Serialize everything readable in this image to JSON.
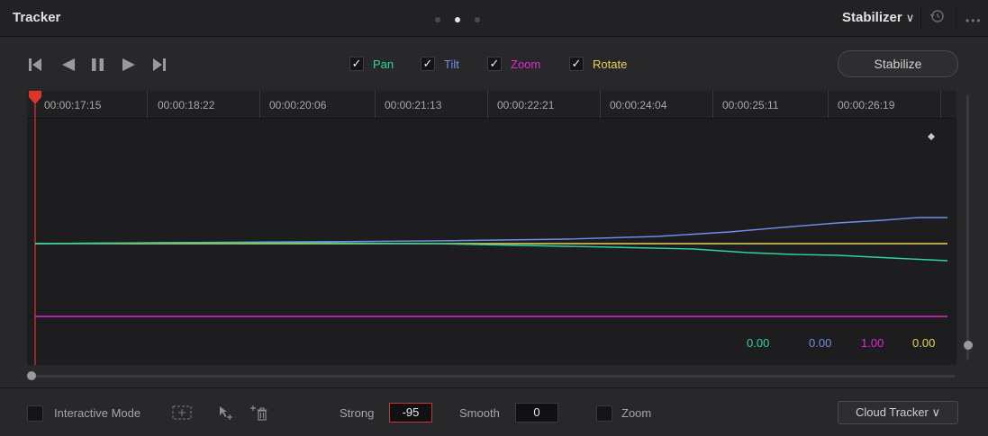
{
  "header": {
    "title": "Tracker",
    "mode_label": "Stabilizer",
    "mode_chevron": "∨",
    "reset_icon": "reset-icon",
    "more_label": "•••"
  },
  "toolbar": {
    "transport": [
      "go-to-start-icon",
      "play-reverse-icon",
      "pause-icon",
      "play-forward-icon",
      "go-to-end-icon"
    ],
    "checks": [
      {
        "label": "Pan",
        "checked": true,
        "color": "#2fd39b"
      },
      {
        "label": "Tilt",
        "checked": true,
        "color": "#6f8fe8"
      },
      {
        "label": "Zoom",
        "checked": true,
        "color": "#e02ad0"
      },
      {
        "label": "Rotate",
        "checked": true,
        "color": "#e6d35a"
      }
    ],
    "check_mark": "✓",
    "stabilize_label": "Stabilize"
  },
  "timeline": {
    "timecodes": [
      "00:00:17:15",
      "00:00:18:22",
      "00:00:20:06",
      "00:00:21:13",
      "00:00:22:21",
      "00:00:24:04",
      "00:00:25:11",
      "00:00:26:19"
    ],
    "playhead_color": "#e0332c"
  },
  "graph": {
    "values": [
      {
        "text": "0.00",
        "color": "#2fd39b"
      },
      {
        "text": "0.00",
        "color": "#6f8fe8"
      },
      {
        "text": "1.00",
        "color": "#e02ad0"
      },
      {
        "text": "0.00",
        "color": "#e6d35a"
      }
    ]
  },
  "footer": {
    "interactive_mode_label": "Interactive Mode",
    "strong_label": "Strong",
    "strong_value": "-95",
    "smooth_label": "Smooth",
    "smooth_value": "0",
    "zoom_label": "Zoom",
    "cloud_tracker_label": "Cloud Tracker",
    "cloud_tracker_chevron": "∨"
  }
}
